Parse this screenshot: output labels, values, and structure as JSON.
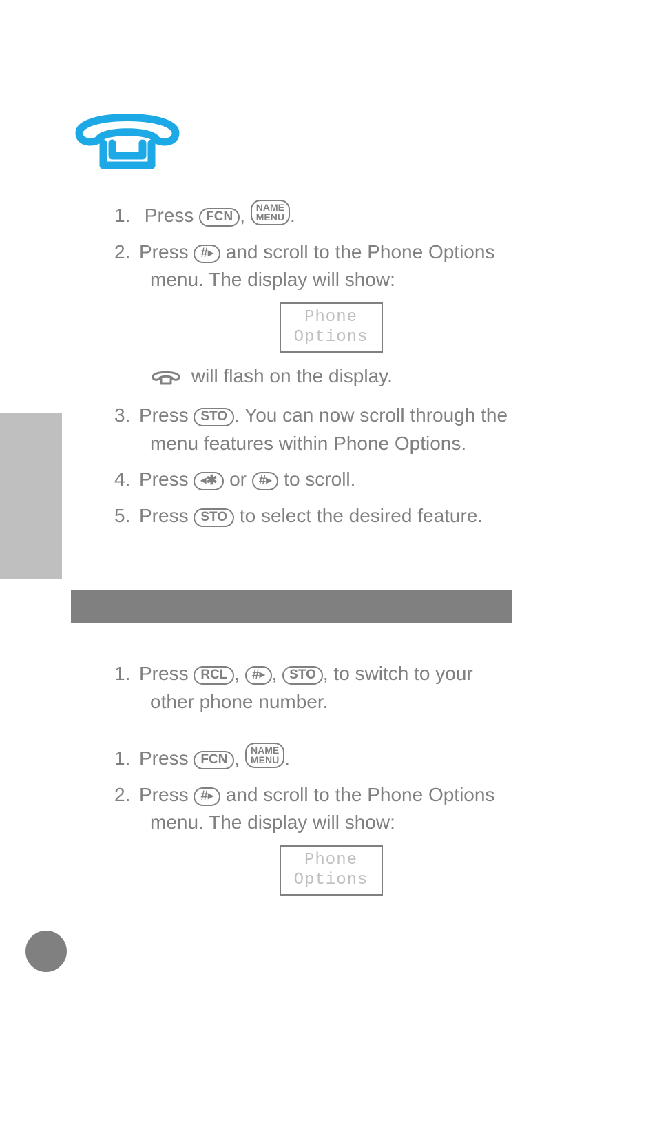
{
  "keys": {
    "fcn": "FCN",
    "name": "NAME",
    "menu": "MENU",
    "sto": "STO",
    "rcl": "RCL",
    "hashRight": "#▸",
    "starLeft": "◂✱"
  },
  "display": {
    "line1": "Phone",
    "line2": "Options"
  },
  "sectionA": {
    "s1a": "Press ",
    "s1b": ", ",
    "s1c": ".",
    "s2a": "Press ",
    "s2b": " and scroll to the Phone Options menu. The display will show:",
    "s2flash": " will flash on the display.",
    "s3a": "Press ",
    "s3b": ". You can now scroll through the menu features within Phone Options.",
    "s4a": "Press ",
    "s4b": " or ",
    "s4c": " to scroll.",
    "s5a": "Press ",
    "s5b": " to select the desired feature."
  },
  "sectionB": {
    "s1a": "Press ",
    "s1b": ", ",
    "s1c": ", ",
    "s1d": ", to switch to your other phone number."
  },
  "sectionC": {
    "s1a": "Press ",
    "s1b": ", ",
    "s1c": ".",
    "s2a": "Press ",
    "s2b": " and scroll to the Phone Options menu. The display will show:"
  },
  "nums": {
    "n1": "1.",
    "n2": "2.",
    "n3": "3.",
    "n4": "4.",
    "n5": "5."
  }
}
